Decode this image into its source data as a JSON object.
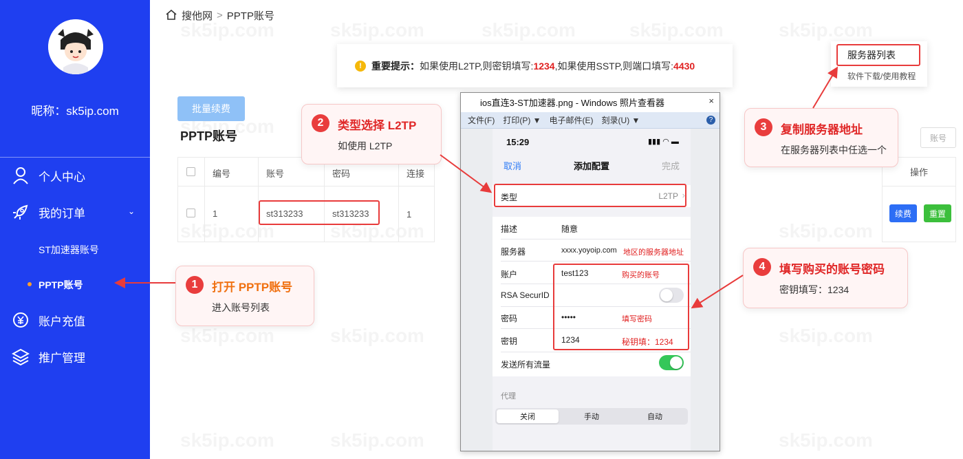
{
  "sidebar": {
    "nickname": "昵称：sk5ip.com",
    "items": [
      {
        "label": "个人中心"
      },
      {
        "label": "我的订单"
      },
      {
        "label": "账户充值"
      },
      {
        "label": "推广管理"
      }
    ],
    "sub_items": [
      {
        "label": "ST加速器账号"
      },
      {
        "label": "PPTP账号"
      }
    ]
  },
  "breadcrumb": {
    "home": "搜他网",
    "sep": ">",
    "current": "PPTP账号"
  },
  "watermark": "sk5ip.com",
  "notice": {
    "label": "重要提示：",
    "text1": "如果使用L2TP,则密钥填写: ",
    "key": "1234",
    "text2": ",如果使用SSTP,则端口填写: ",
    "port": "4430"
  },
  "toolbar": {
    "batch_renew": "批量续费",
    "account_btn": "账号"
  },
  "page_title": "PPTP账号",
  "table": {
    "headers": [
      "编号",
      "账号",
      "密码",
      "连接"
    ],
    "rows": [
      [
        "1",
        "st313233",
        "st313233",
        "1"
      ]
    ],
    "op_header": "操作",
    "renew": "续费",
    "reset": "重置"
  },
  "server_popup": {
    "title": "服务器列表",
    "sub": "软件下载/使用教程"
  },
  "callouts": [
    {
      "num": "1",
      "title": "打开 PPTP账号",
      "sub": "进入账号列表"
    },
    {
      "num": "2",
      "title": "类型选择 L2TP",
      "sub": "如使用 L2TP"
    },
    {
      "num": "3",
      "title": "复制服务器地址",
      "sub": "在服务器列表中任选一个"
    },
    {
      "num": "4",
      "title": "填写购买的账号密码",
      "sub": "密钥填写：1234"
    }
  ],
  "viewer": {
    "title": "ios直连3-ST加速器.png - Windows 照片查看器",
    "menu": [
      "文件(F)",
      "打印(P) ▼",
      "电子邮件(E)",
      "刻录(U) ▼"
    ],
    "close": "×",
    "help": "?"
  },
  "phone": {
    "time": "15:29",
    "status": "▮▮▮ ◠ ▬",
    "nav_cancel": "取消",
    "nav_title": "添加配置",
    "nav_done": "完成",
    "type_label": "类型",
    "type_value": "L2TP",
    "desc_label": "描述",
    "desc_value": "随意",
    "server_label": "服务器",
    "server_value": "xxxx.yoyoip.com",
    "server_note": "地区的服务器地址",
    "account_label": "账户",
    "account_value": "test123",
    "account_note": "购买的账号",
    "rsa_label": "RSA SecurID",
    "password_label": "密码",
    "password_value": "•••••",
    "password_note": "填写密码",
    "secret_label": "密钥",
    "secret_value": "1234",
    "secret_note": "秘钥填：1234",
    "send_all_label": "发送所有流量",
    "proxy_label": "代理",
    "proxy_options": [
      "关闭",
      "手动",
      "自动"
    ]
  },
  "colors": {
    "sidebar": "#1f3ff0",
    "accent_red": "#e83b3b",
    "toggle_on": "#34c759",
    "renew_btn": "#2d6ef5",
    "reset_btn": "#3cbf3c"
  }
}
